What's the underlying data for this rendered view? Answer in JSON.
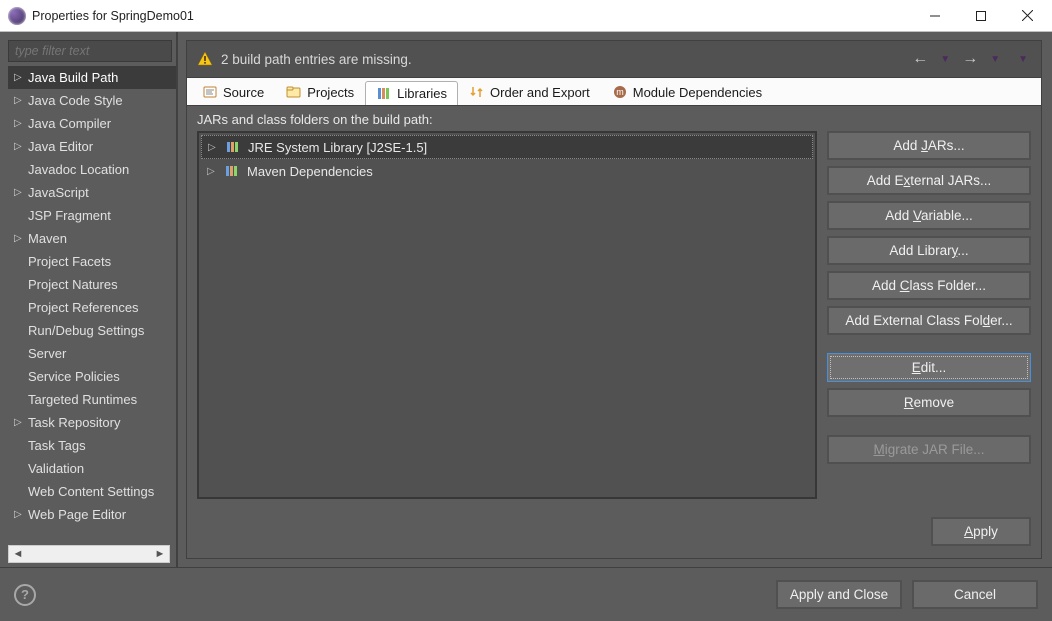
{
  "window": {
    "title": "Properties for SpringDemo01"
  },
  "sidebar": {
    "filter_placeholder": "type filter text",
    "items": [
      {
        "label": "Java Build Path",
        "expandable": true,
        "selected": true
      },
      {
        "label": "Java Code Style",
        "expandable": true
      },
      {
        "label": "Java Compiler",
        "expandable": true
      },
      {
        "label": "Java Editor",
        "expandable": true
      },
      {
        "label": "Javadoc Location",
        "expandable": false
      },
      {
        "label": "JavaScript",
        "expandable": true
      },
      {
        "label": "JSP Fragment",
        "expandable": false
      },
      {
        "label": "Maven",
        "expandable": true
      },
      {
        "label": "Project Facets",
        "expandable": false
      },
      {
        "label": "Project Natures",
        "expandable": false
      },
      {
        "label": "Project References",
        "expandable": false
      },
      {
        "label": "Run/Debug Settings",
        "expandable": false
      },
      {
        "label": "Server",
        "expandable": false
      },
      {
        "label": "Service Policies",
        "expandable": false
      },
      {
        "label": "Targeted Runtimes",
        "expandable": false
      },
      {
        "label": "Task Repository",
        "expandable": true
      },
      {
        "label": "Task Tags",
        "expandable": false
      },
      {
        "label": "Validation",
        "expandable": false
      },
      {
        "label": "Web Content Settings",
        "expandable": false
      },
      {
        "label": "Web Page Editor",
        "expandable": true
      }
    ]
  },
  "banner": {
    "message": "2 build path entries are missing."
  },
  "tabs": [
    {
      "icon": "source",
      "label": "Source"
    },
    {
      "icon": "projects",
      "label": "Projects"
    },
    {
      "icon": "libraries",
      "label": "Libraries",
      "active": true
    },
    {
      "icon": "order",
      "label": "Order and Export"
    },
    {
      "icon": "module",
      "label": "Module Dependencies"
    }
  ],
  "panel": {
    "label": "JARs and class folders on the build path:",
    "items": [
      {
        "label": "JRE System Library [J2SE-1.5]",
        "selected": true
      },
      {
        "label": "Maven Dependencies"
      }
    ]
  },
  "buttons": {
    "add_jars": "Add JARs...",
    "add_external_jars": "Add External JARs...",
    "add_variable": "Add Variable...",
    "add_library": "Add Library...",
    "add_class_folder": "Add Class Folder...",
    "add_external_class_folder": "Add External Class Folder...",
    "edit": "Edit...",
    "remove": "Remove",
    "migrate": "Migrate JAR File...",
    "apply": "Apply"
  },
  "footer": {
    "apply_close": "Apply and Close",
    "cancel": "Cancel"
  }
}
